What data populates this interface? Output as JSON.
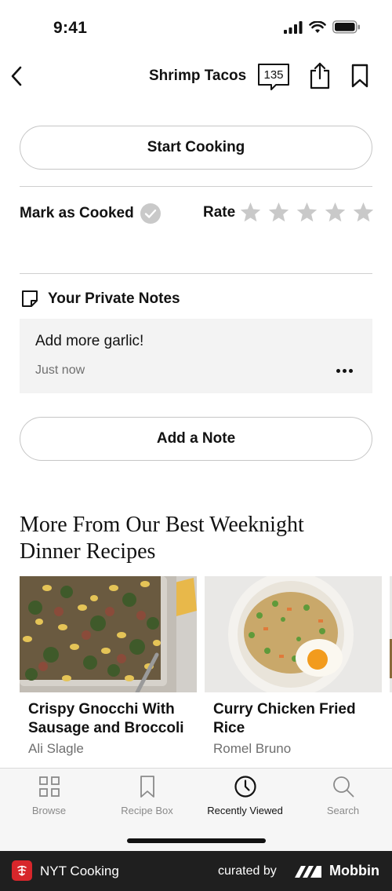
{
  "status_bar": {
    "time": "9:41"
  },
  "nav": {
    "title": "Shrimp Tacos",
    "comments_count": "135"
  },
  "actions": {
    "start_cooking": "Start Cooking",
    "mark_as_cooked": "Mark as Cooked",
    "rate_label": "Rate",
    "rating": {
      "value": 0,
      "max": 5
    }
  },
  "notes": {
    "title": "Your Private Notes",
    "items": [
      {
        "text": "Add more garlic!",
        "time": "Just now"
      }
    ],
    "add_note": "Add a Note"
  },
  "more_section": {
    "title": "More From Our Best Weeknight Dinner Recipes",
    "cards": [
      {
        "title": "Crispy Gnocchi With Sausage and Broccoli",
        "author": "Ali Slagle"
      },
      {
        "title": "Curry Chicken Fried Rice",
        "author": "Romel Bruno"
      }
    ]
  },
  "tabs": [
    {
      "label": "Browse",
      "icon": "grid-icon",
      "active": false
    },
    {
      "label": "Recipe Box",
      "icon": "bookmark-icon",
      "active": false
    },
    {
      "label": "Recently Viewed",
      "icon": "clock-icon",
      "active": true
    },
    {
      "label": "Search",
      "icon": "search-icon",
      "active": false
    }
  ],
  "footer": {
    "app_name": "NYT Cooking",
    "curated_by": "curated by",
    "brand": "Mobbin"
  },
  "colors": {
    "accent": "#121212",
    "muted_text": "#6f6f6f",
    "star_empty": "#c9c9c9",
    "note_bg": "#f3f3f3",
    "tab_bar_bg": "#f6f6f6",
    "nyt_red": "#d7262b"
  }
}
